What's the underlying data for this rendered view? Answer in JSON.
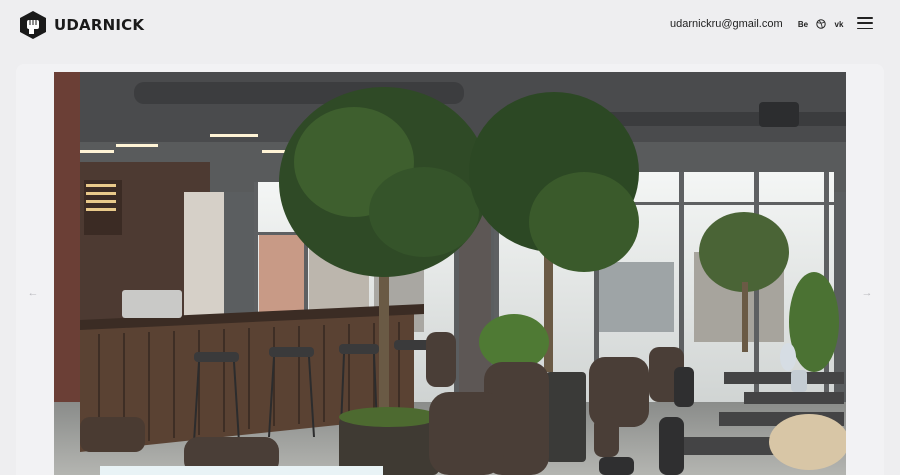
{
  "header": {
    "logo_text": "UDARNICK",
    "email": "udarnickru@gmail.com",
    "socials": [
      {
        "label": "Be",
        "icon": "behance-icon"
      },
      {
        "label": "",
        "icon": "dribbble-icon"
      },
      {
        "label": "vk",
        "icon": "vk-icon"
      }
    ]
  },
  "slider": {
    "prev_icon": "arrow-left-icon",
    "next_icon": "arrow-right-icon"
  },
  "colors": {
    "background": "#eeeef0",
    "text": "#1c1c1e",
    "caption_card": "#e9f3f6"
  }
}
